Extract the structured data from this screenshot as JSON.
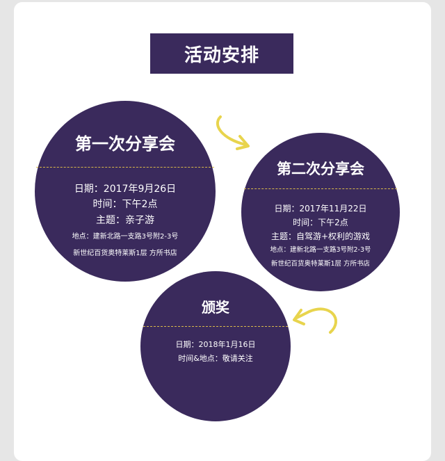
{
  "title": "活动安排",
  "events": [
    {
      "name": "第一次分享会",
      "date": "日期：2017年9月26日",
      "time": "时间：下午2点",
      "theme": "主题：亲子游",
      "address": "地点：建新北路一支路3号附2-3号",
      "venue": "新世纪百货奥特莱斯1层 方所书店"
    },
    {
      "name": "第二次分享会",
      "date": "日期：2017年11月22日",
      "time": "时间：下午2点",
      "theme": "主题：自驾游+权利的游戏",
      "address": "地点：建新北路一支路3号附2-3号",
      "venue": "新世纪百货奥特莱斯1层 方所书店"
    },
    {
      "name": "颁奖",
      "date": "日期：2018年1月16日",
      "time": "时间&地点：敬请关注"
    }
  ],
  "colors": {
    "primary": "#3a2a5c",
    "accent": "#e8d44d"
  }
}
